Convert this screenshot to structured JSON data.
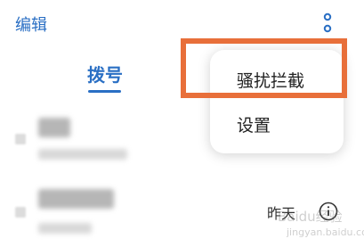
{
  "header": {
    "edit_label": "编辑",
    "more_icon": "more-vertical-icon"
  },
  "tabs": [
    {
      "label": "拨号",
      "active": true
    }
  ],
  "popup_menu": {
    "items": [
      {
        "label": "骚扰拦截",
        "highlighted": true
      },
      {
        "label": "设置"
      }
    ]
  },
  "call_log": {
    "rows": [
      {
        "name": "",
        "subtitle": "",
        "time": ""
      },
      {
        "name": "",
        "subtitle": "",
        "time": "昨天"
      }
    ]
  },
  "watermark": {
    "line1": "Baidu经验",
    "line2": "jingyan.baidu.com"
  },
  "colors": {
    "accent": "#2a6fc4",
    "highlight": "#e86f3a"
  }
}
